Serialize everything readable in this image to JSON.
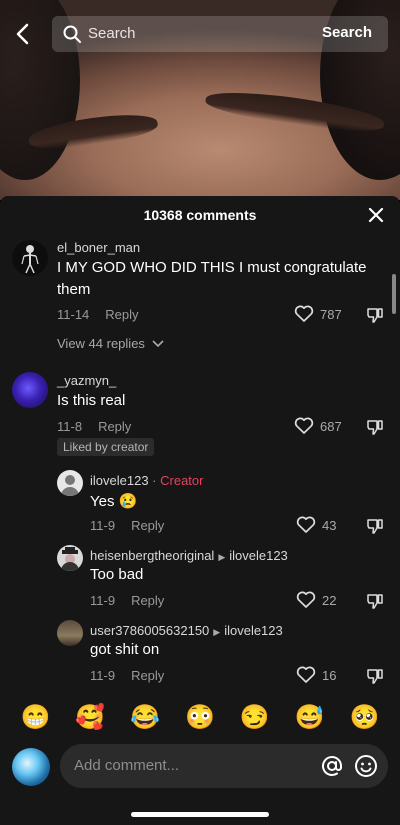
{
  "topbar": {
    "search_placeholder": "Search",
    "search_button": "Search"
  },
  "comments_header": {
    "title": "10368 comments"
  },
  "comments": [
    {
      "username": "el_boner_man",
      "text": "I MY GOD WHO DID THIS I must congratulate them",
      "date": "11-14",
      "reply": "Reply",
      "likes": "787",
      "view_replies": "View 44 replies"
    },
    {
      "username": "_yazmyn_",
      "text": "Is this real",
      "date": "11-8",
      "reply": "Reply",
      "likes": "687",
      "badge": "Liked by creator"
    }
  ],
  "replies": [
    {
      "username": "ilovele123",
      "creator_label": "Creator",
      "text": "Yes 😢",
      "date": "11-9",
      "reply": "Reply",
      "likes": "43"
    },
    {
      "username": "heisenbergtheoriginal",
      "reply_to": "ilovele123",
      "text": "Too bad",
      "date": "11-9",
      "reply": "Reply",
      "likes": "22"
    },
    {
      "username": "user3786005632150",
      "reply_to": "ilovele123",
      "text": "got shit on",
      "date": "11-9",
      "reply": "Reply",
      "likes": "16"
    }
  ],
  "emoji_bar": [
    "😁",
    "🥰",
    "😂",
    "😳",
    "😏",
    "😅",
    "🥺"
  ],
  "composer": {
    "placeholder": "Add comment..."
  },
  "colors": {
    "sheet_bg": "#161616",
    "creator_accent": "#e0445e",
    "input_bg": "#2b2b2b"
  }
}
